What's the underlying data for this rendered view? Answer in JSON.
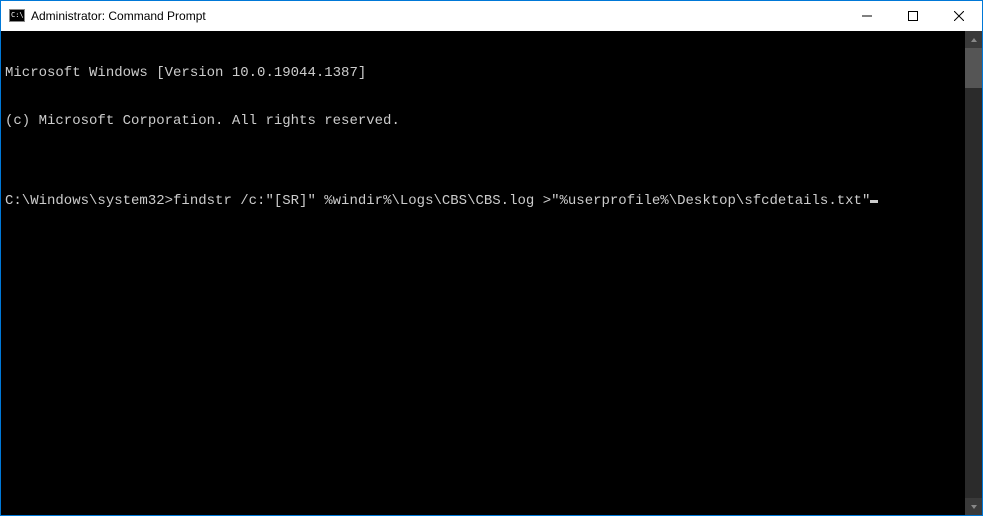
{
  "window": {
    "title": "Administrator: Command Prompt"
  },
  "console": {
    "line1": "Microsoft Windows [Version 10.0.19044.1387]",
    "line2": "(c) Microsoft Corporation. All rights reserved.",
    "blank": "",
    "prompt": "C:\\Windows\\system32>",
    "command": "findstr /c:\"[SR]\" %windir%\\Logs\\CBS\\CBS.log >\"%userprofile%\\Desktop\\sfcdetails.txt\""
  }
}
